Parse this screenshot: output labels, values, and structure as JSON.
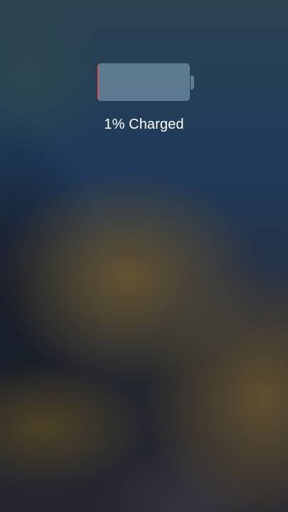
{
  "battery": {
    "level_fraction": 0.01,
    "level_color": "#d9534f",
    "body_color": "#7fa0b4",
    "status_text": "1% Charged"
  }
}
